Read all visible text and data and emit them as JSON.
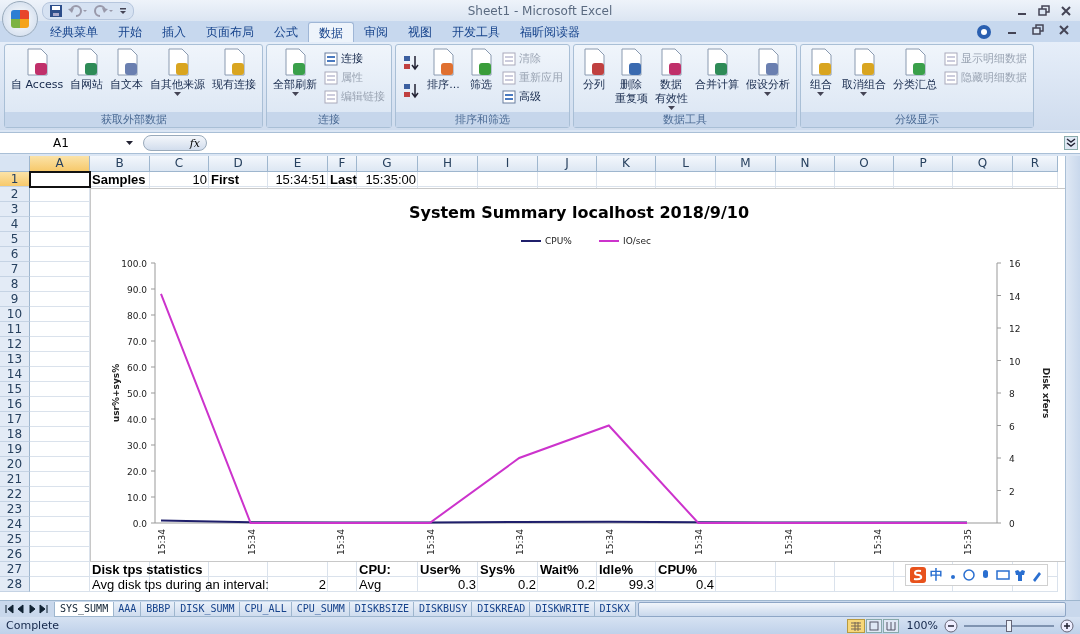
{
  "window": {
    "title": "Sheet1 - Microsoft Excel"
  },
  "ribbon_tabs": [
    {
      "label": "经典菜单",
      "selected": false
    },
    {
      "label": "开始",
      "selected": false
    },
    {
      "label": "插入",
      "selected": false
    },
    {
      "label": "页面布局",
      "selected": false
    },
    {
      "label": "公式",
      "selected": false
    },
    {
      "label": "数据",
      "selected": true
    },
    {
      "label": "审阅",
      "selected": false
    },
    {
      "label": "视图",
      "selected": false
    },
    {
      "label": "开发工具",
      "selected": false
    },
    {
      "label": "福昕阅读器",
      "selected": false
    }
  ],
  "ribbon_groups": [
    {
      "title": "获取外部数据",
      "items": [
        {
          "kind": "large",
          "lines": [
            "自 Access"
          ],
          "disabled": false,
          "dropdown": false
        },
        {
          "kind": "large",
          "lines": [
            "自网站"
          ],
          "disabled": false,
          "dropdown": false
        },
        {
          "kind": "large",
          "lines": [
            "自文本"
          ],
          "disabled": false,
          "dropdown": false
        },
        {
          "kind": "large",
          "lines": [
            "自其他来源"
          ],
          "disabled": false,
          "dropdown": true
        },
        {
          "kind": "large",
          "lines": [
            "现有连接"
          ],
          "disabled": false,
          "dropdown": false
        }
      ]
    },
    {
      "title": "连接",
      "items": [
        {
          "kind": "large",
          "lines": [
            "全部刷新"
          ],
          "disabled": false,
          "dropdown": true
        },
        {
          "kind": "small",
          "label": "连接",
          "disabled": false
        },
        {
          "kind": "small",
          "label": "属性",
          "disabled": true
        },
        {
          "kind": "small",
          "label": "编辑链接",
          "disabled": true
        }
      ]
    },
    {
      "title": "排序和筛选",
      "items": [
        {
          "kind": "icon",
          "disabled": false
        },
        {
          "kind": "icon",
          "disabled": false
        },
        {
          "kind": "large",
          "lines": [
            "排序..."
          ],
          "disabled": false,
          "dropdown": false
        },
        {
          "kind": "large",
          "lines": [
            "筛选"
          ],
          "disabled": false,
          "dropdown": false
        },
        {
          "kind": "small",
          "label": "清除",
          "disabled": true
        },
        {
          "kind": "small",
          "label": "重新应用",
          "disabled": true
        },
        {
          "kind": "small",
          "label": "高级",
          "disabled": false
        }
      ]
    },
    {
      "title": "数据工具",
      "items": [
        {
          "kind": "large",
          "lines": [
            "分列"
          ],
          "disabled": false,
          "dropdown": false
        },
        {
          "kind": "large",
          "lines": [
            "删除",
            "重复项"
          ],
          "disabled": false,
          "dropdown": false
        },
        {
          "kind": "large",
          "lines": [
            "数据",
            "有效性"
          ],
          "disabled": false,
          "dropdown": true
        },
        {
          "kind": "large",
          "lines": [
            "合并计算"
          ],
          "disabled": false,
          "dropdown": false
        },
        {
          "kind": "large",
          "lines": [
            "假设分析"
          ],
          "disabled": false,
          "dropdown": true
        }
      ]
    },
    {
      "title": "分级显示",
      "items": [
        {
          "kind": "large",
          "lines": [
            "组合"
          ],
          "disabled": false,
          "dropdown": true
        },
        {
          "kind": "large",
          "lines": [
            "取消组合"
          ],
          "disabled": false,
          "dropdown": true
        },
        {
          "kind": "large",
          "lines": [
            "分类汇总"
          ],
          "disabled": false,
          "dropdown": false
        },
        {
          "kind": "small",
          "label": "显示明细数据",
          "disabled": true
        },
        {
          "kind": "small",
          "label": "隐藏明细数据",
          "disabled": true
        }
      ]
    }
  ],
  "formula_bar": {
    "name_box": "A1",
    "function_label": "fx"
  },
  "columns": [
    {
      "label": "A",
      "selected": true
    },
    {
      "label": "B",
      "selected": false
    },
    {
      "label": "C",
      "selected": false
    },
    {
      "label": "D",
      "selected": false
    },
    {
      "label": "E",
      "selected": false
    },
    {
      "label": "F",
      "selected": false
    },
    {
      "label": "G",
      "selected": false
    },
    {
      "label": "H",
      "selected": false
    },
    {
      "label": "I",
      "selected": false
    },
    {
      "label": "J",
      "selected": false
    },
    {
      "label": "K",
      "selected": false
    },
    {
      "label": "L",
      "selected": false
    },
    {
      "label": "M",
      "selected": false
    },
    {
      "label": "N",
      "selected": false
    },
    {
      "label": "O",
      "selected": false
    },
    {
      "label": "P",
      "selected": false
    },
    {
      "label": "Q",
      "selected": false
    },
    {
      "label": "R",
      "selected": false
    }
  ],
  "rows": [
    {
      "label": "1",
      "selected": true,
      "cells": [
        {
          "kind": "empty"
        },
        {
          "kind": "text",
          "text": "Samples",
          "bold": true
        },
        {
          "kind": "number",
          "text": "10",
          "bold": false
        },
        {
          "kind": "text",
          "text": "First",
          "bold": true
        },
        {
          "kind": "number",
          "text": "15:34:51",
          "bold": false
        },
        {
          "kind": "text",
          "text": "Last",
          "bold": true
        },
        {
          "kind": "number",
          "text": "15:35:00",
          "bold": false
        }
      ]
    },
    {
      "label": "2",
      "selected": false
    },
    {
      "label": "3",
      "selected": false
    },
    {
      "label": "4",
      "selected": false
    },
    {
      "label": "5",
      "selected": false
    },
    {
      "label": "6",
      "selected": false
    },
    {
      "label": "7",
      "selected": false
    },
    {
      "label": "8",
      "selected": false
    },
    {
      "label": "9",
      "selected": false
    },
    {
      "label": "10",
      "selected": false
    },
    {
      "label": "11",
      "selected": false
    },
    {
      "label": "12",
      "selected": false
    },
    {
      "label": "13",
      "selected": false
    },
    {
      "label": "14",
      "selected": false
    },
    {
      "label": "15",
      "selected": false
    },
    {
      "label": "16",
      "selected": false
    },
    {
      "label": "17",
      "selected": false
    },
    {
      "label": "18",
      "selected": false
    },
    {
      "label": "19",
      "selected": false
    },
    {
      "label": "20",
      "selected": false
    },
    {
      "label": "21",
      "selected": false
    },
    {
      "label": "22",
      "selected": false
    },
    {
      "label": "23",
      "selected": false
    },
    {
      "label": "24",
      "selected": false
    },
    {
      "label": "25",
      "selected": false
    },
    {
      "label": "26",
      "selected": false
    },
    {
      "label": "27",
      "selected": false,
      "cells": [
        {
          "kind": "empty"
        },
        {
          "kind": "text",
          "text": "Disk tps statistics",
          "bold": true
        },
        {
          "kind": "empty"
        },
        {
          "kind": "empty"
        },
        {
          "kind": "empty"
        },
        {
          "kind": "empty"
        },
        {
          "kind": "text",
          "text": "CPU:",
          "bold": true
        },
        {
          "kind": "text",
          "text": "User%",
          "bold": true
        },
        {
          "kind": "text",
          "text": "Sys%",
          "bold": true
        },
        {
          "kind": "text",
          "text": "Wait%",
          "bold": true
        },
        {
          "kind": "text",
          "text": "Idle%",
          "bold": true
        },
        {
          "kind": "text",
          "text": "CPU%",
          "bold": true
        }
      ]
    },
    {
      "label": "28",
      "selected": false,
      "cells": [
        {
          "kind": "empty"
        },
        {
          "kind": "text",
          "text": "Avg disk tps during an interval:",
          "bold": false
        },
        {
          "kind": "empty"
        },
        {
          "kind": "empty"
        },
        {
          "kind": "number",
          "text": "2",
          "bold": false
        },
        {
          "kind": "empty"
        },
        {
          "kind": "text",
          "text": "Avg",
          "bold": false
        },
        {
          "kind": "number",
          "text": "0.3",
          "bold": false
        },
        {
          "kind": "number",
          "text": "0.2",
          "bold": false
        },
        {
          "kind": "number",
          "text": "0.2",
          "bold": false
        },
        {
          "kind": "number",
          "text": "99.3",
          "bold": false
        },
        {
          "kind": "number",
          "text": "0.4",
          "bold": false
        }
      ]
    }
  ],
  "chart": {
    "chart_data": {
      "type": "line",
      "title": "System Summary localhost  2018/9/10",
      "ylabel": "usr%+sys%",
      "legend": "top",
      "categories": [
        "15:34",
        "15:34",
        "15:34",
        "15:34",
        "15:34",
        "15:34",
        "15:34",
        "15:34",
        "15:34",
        "15:35"
      ],
      "series": [
        {
          "name": "CPU%",
          "color": "#1f1f6b",
          "values": [
            1.0,
            0.3,
            0.2,
            0.2,
            0.4,
            0.5,
            0.3,
            0.2,
            0.2,
            0.2
          ]
        },
        {
          "name": "IO/sec",
          "color": "#cc33cc",
          "axis": "y2",
          "values": [
            14.1,
            0,
            0,
            0,
            4,
            6,
            0,
            0,
            0,
            0
          ]
        }
      ],
      "ylim": [
        0,
        100
      ],
      "yticks": [
        {
          "value": 0,
          "label": "0.0"
        },
        {
          "value": 10,
          "label": "10.0"
        },
        {
          "value": 20,
          "label": "20.0"
        },
        {
          "value": 30,
          "label": "30.0"
        },
        {
          "value": 40,
          "label": "40.0"
        },
        {
          "value": 50,
          "label": "50.0"
        },
        {
          "value": 60,
          "label": "60.0"
        },
        {
          "value": 70,
          "label": "70.0"
        },
        {
          "value": 80,
          "label": "80.0"
        },
        {
          "value": 90,
          "label": "90.0"
        },
        {
          "value": 100,
          "label": "100.0"
        }
      ],
      "y2label": "Disk xfers",
      "y2lim": [
        0,
        16
      ],
      "y2ticks": [
        0,
        2,
        4,
        6,
        8,
        10,
        12,
        14,
        16
      ]
    }
  },
  "sheet_tabs": [
    {
      "label": "SYS_SUMM",
      "selected": true
    },
    {
      "label": "AAA",
      "selected": false
    },
    {
      "label": "BBBP",
      "selected": false
    },
    {
      "label": "DISK_SUMM",
      "selected": false
    },
    {
      "label": "CPU_ALL",
      "selected": false
    },
    {
      "label": "CPU_SUMM",
      "selected": false
    },
    {
      "label": "DISKBSIZE",
      "selected": false
    },
    {
      "label": "DISKBUSY",
      "selected": false
    },
    {
      "label": "DISKREAD",
      "selected": false
    },
    {
      "label": "DISKWRITE",
      "selected": false
    },
    {
      "label": "DISKX",
      "selected": false
    }
  ],
  "status_bar": {
    "text": "Complete",
    "zoom": "100%",
    "zoom_level": {
      "level": 0.5
    }
  },
  "ime_toolbar": {
    "mode": "中"
  }
}
